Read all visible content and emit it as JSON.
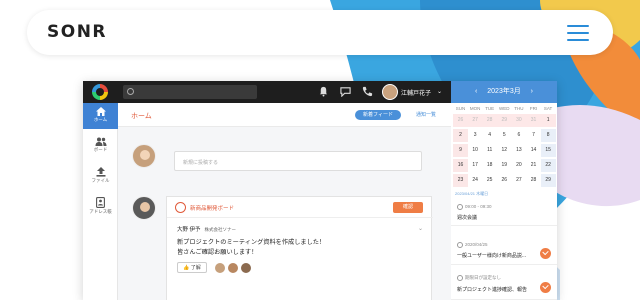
{
  "brand": {
    "logo": "SONR"
  },
  "app": {
    "header": {
      "user_name": "江輔戸花子",
      "caret": "⌄"
    },
    "sidebar": {
      "items": [
        {
          "label": "ホーム"
        },
        {
          "label": "ボード"
        },
        {
          "label": "ファイル"
        },
        {
          "label": "アドレス帳"
        }
      ]
    },
    "main": {
      "title": "ホーム",
      "tabs": {
        "primary": "新着フィード",
        "secondary": "通知一覧"
      },
      "post_placeholder": "新規に投稿する",
      "card": {
        "board_name": "新商品開発ボード",
        "confirm_label": "確認",
        "author": "大野 伊予",
        "company": "株式会社ソナー",
        "message_line1": "新プロジェクトのミーティング資料を作成しました！",
        "message_line2": "皆さんご確認お願いします！",
        "like_label": "了解"
      }
    },
    "calendar": {
      "title": "2023年3月",
      "prev": "‹",
      "next": "›",
      "weekdays": [
        "SUN",
        "MON",
        "TUE",
        "WED",
        "THU",
        "FRI",
        "SAT"
      ],
      "rows": [
        [
          "26",
          "27",
          "28",
          "29",
          "30",
          "31",
          "1"
        ],
        [
          "2",
          "3",
          "4",
          "5",
          "6",
          "7",
          "8"
        ],
        [
          "9",
          "10",
          "11",
          "12",
          "13",
          "14",
          "15"
        ],
        [
          "16",
          "17",
          "18",
          "19",
          "20",
          "21",
          "22"
        ],
        [
          "23",
          "24",
          "25",
          "26",
          "27",
          "28",
          "29"
        ]
      ],
      "caption": "2023/04/21 木曜日",
      "events": [
        {
          "time": "09:00 - 09:30",
          "title": "週次会議"
        },
        {
          "time": "2020/04/25",
          "title": "一般ユーザー様向け新商品説..."
        },
        {
          "time": "期限日が設定なし",
          "title": "新プロジェクト進捗確認、報告"
        }
      ]
    }
  },
  "colors": {
    "accent": "#4a90d9",
    "orange": "#ef7d45",
    "header_bg": "#1e1e1e"
  }
}
